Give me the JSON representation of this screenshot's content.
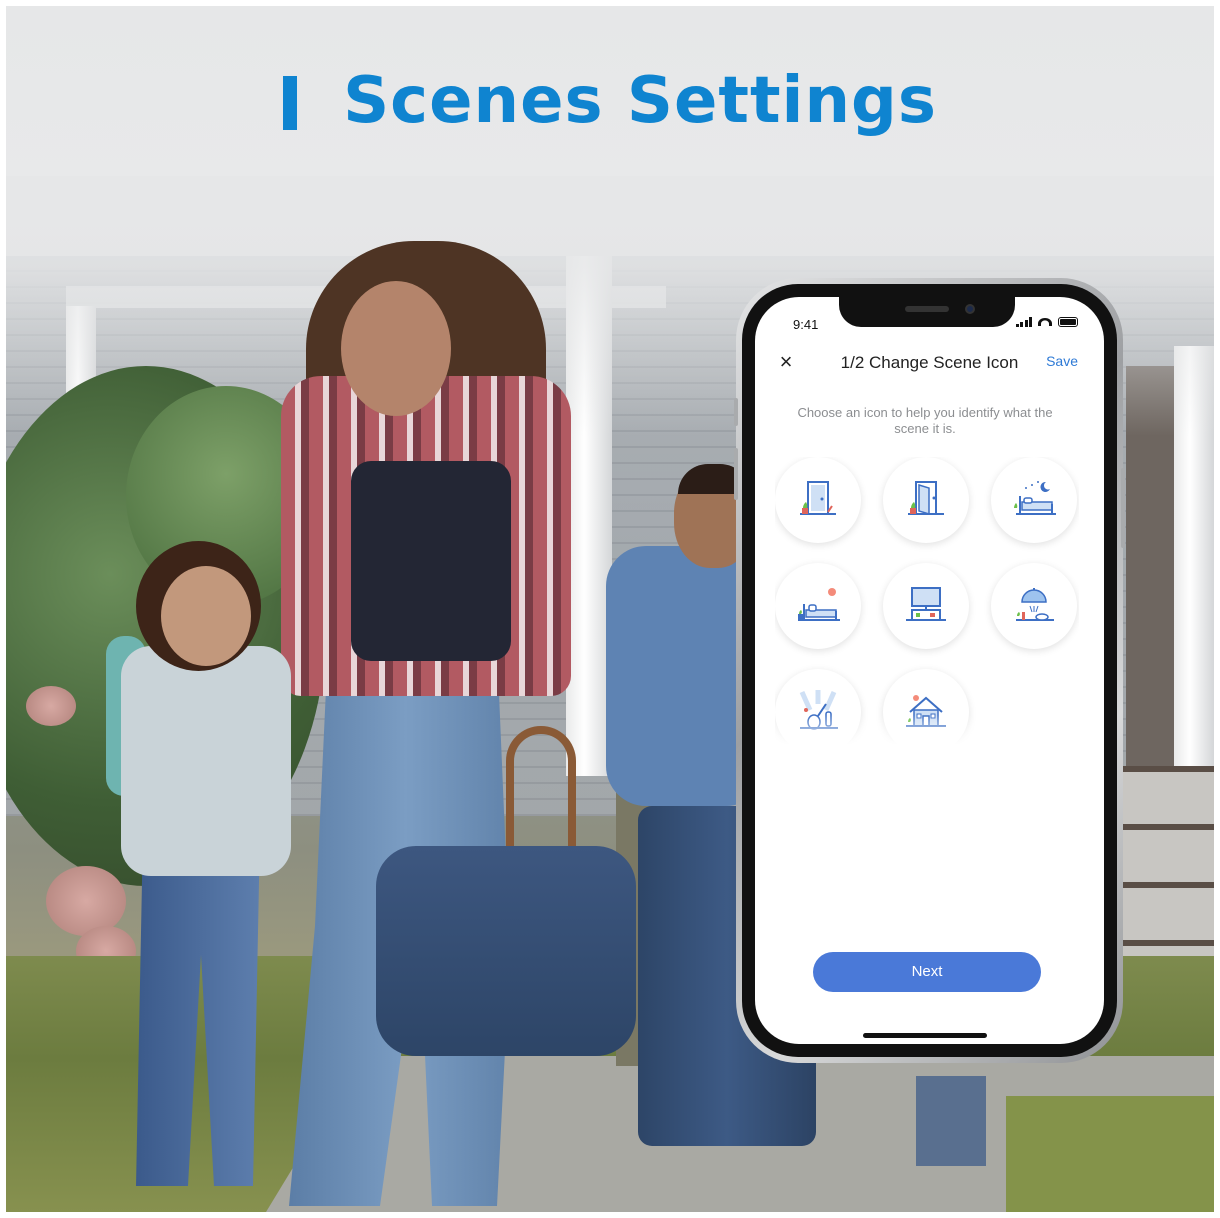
{
  "banner": {
    "title": "Scenes Settings",
    "accent_color": "#0f84d0"
  },
  "phone": {
    "status_bar": {
      "time": "9:41",
      "icons": [
        "signal-icon",
        "wifi-icon",
        "battery-icon"
      ]
    },
    "nav": {
      "close_icon": "close-icon",
      "title": "1/2 Change Scene Icon",
      "save_label": "Save"
    },
    "hint": "Choose an icon to help you identify what the scene it is.",
    "scene_icons": [
      {
        "name": "leave-home-door-icon"
      },
      {
        "name": "arrive-home-door-icon"
      },
      {
        "name": "sleep-night-bed-icon"
      },
      {
        "name": "wake-up-bed-icon"
      },
      {
        "name": "tv-movie-icon"
      },
      {
        "name": "dinner-dining-icon"
      },
      {
        "name": "party-music-icon"
      },
      {
        "name": "house-away-icon"
      }
    ],
    "next_label": "Next",
    "colors": {
      "save": "#2e7ad6",
      "next_button": "#4a79d8",
      "hint_text": "#8c8e91"
    }
  }
}
